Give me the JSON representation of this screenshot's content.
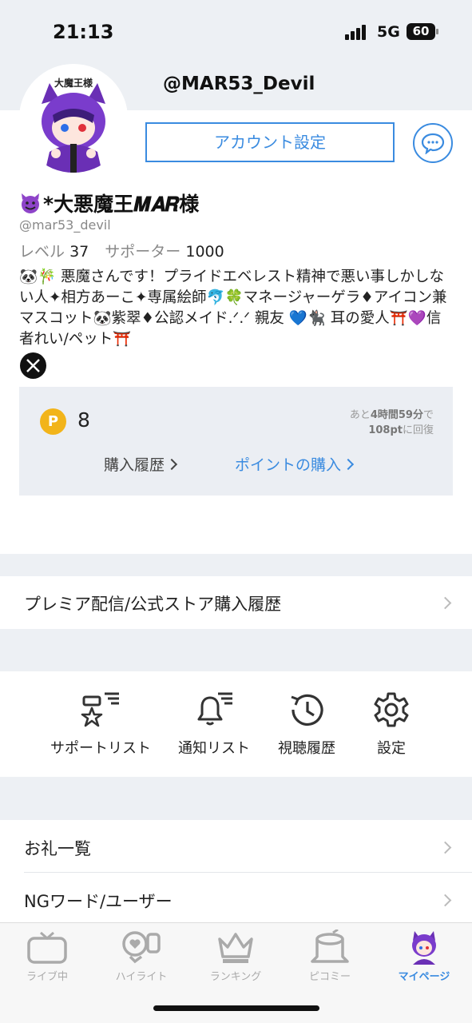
{
  "status": {
    "time": "21:13",
    "network": "5G",
    "battery": "60"
  },
  "header": {
    "handle": "@MAR53_Devil"
  },
  "profile": {
    "account_settings_label": "アカウント設定",
    "display_name": "*大悪魔王𝑴𝑨𝑹様",
    "user_id": "@mar53_devil",
    "level_label": "レベル",
    "level_value": "37",
    "supporter_label": "サポーター",
    "supporter_value": "1000",
    "bio": "🐼🎋 悪魔さんです！プライドエベレスト精神で悪い事しかしない人✦相方あーこ✦専属絵師🐬🍀マネージャーゲラ♦アイコン兼マスコット🐼紫翠♦公認メイド.ᐟ.ᐟ 親友 💙🐈‍⬛ 耳の愛人⛩️💜信者れい/ペット⛩️"
  },
  "points": {
    "icon_letter": "P",
    "value": "8",
    "recovery_prefix": "あと",
    "recovery_time": "4時間59分",
    "recovery_mid": "で",
    "recovery_amount": "108pt",
    "recovery_suffix": "に回復",
    "history_label": "購入履歴",
    "buy_label": "ポイントの購入"
  },
  "menu": {
    "premium_history": "プレミア配信/公式ストア購入履歴",
    "thanks_list": "お礼一覧",
    "ng_words": "NGワード/ユーザー"
  },
  "shortcuts": [
    {
      "label": "サポートリスト",
      "icon": "support-list-icon"
    },
    {
      "label": "通知リスト",
      "icon": "notification-list-icon"
    },
    {
      "label": "視聴履歴",
      "icon": "history-icon"
    },
    {
      "label": "設定",
      "icon": "gear-icon"
    }
  ],
  "tabs": [
    {
      "label": "ライブ中",
      "icon": "tv-icon"
    },
    {
      "label": "ハイライト",
      "icon": "highlight-icon"
    },
    {
      "label": "ランキング",
      "icon": "crown-icon"
    },
    {
      "label": "ピコミー",
      "icon": "stump-icon"
    },
    {
      "label": "マイページ",
      "icon": "avatar-icon",
      "active": true
    }
  ],
  "colors": {
    "accent": "#3a8be0",
    "point": "#f2b41a",
    "background": "#edf0f4"
  }
}
